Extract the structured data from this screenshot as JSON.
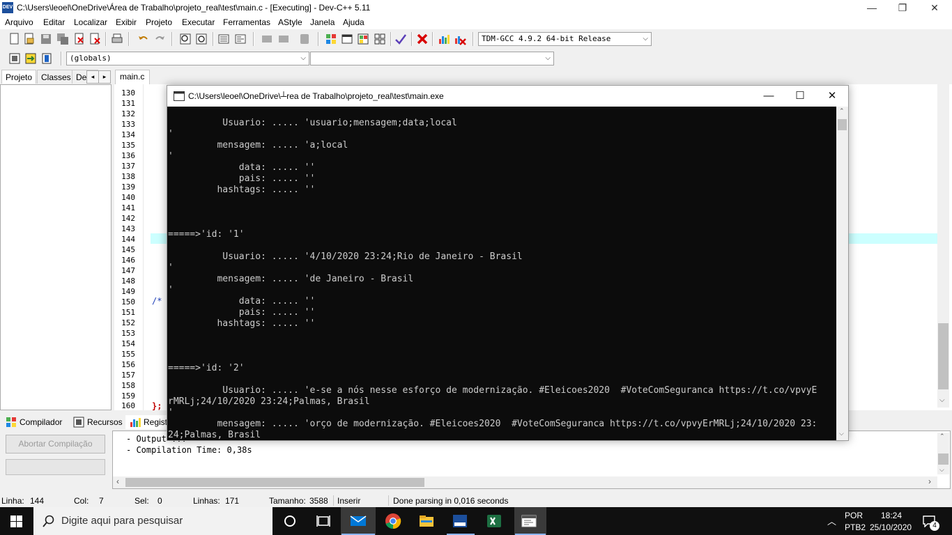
{
  "window": {
    "title": "C:\\Users\\leoel\\OneDrive\\Área de Trabalho\\projeto_real\\test\\main.c - [Executing] - Dev-C++ 5.11",
    "app_icon_text": "DEV",
    "minimize": "—",
    "maximize": "❐",
    "close": "✕"
  },
  "menu": [
    "Arquivo",
    "Editar",
    "Localizar",
    "Exibir",
    "Projeto",
    "Executar",
    "Ferramentas",
    "AStyle",
    "Janela",
    "Ajuda"
  ],
  "toolbar": {
    "compiler_select": "TDM-GCC 4.9.2 64-bit Release",
    "scope_select": "(globals)",
    "member_select": ""
  },
  "left_panel": {
    "tabs": [
      "Projeto",
      "Classes",
      "De"
    ]
  },
  "editor": {
    "tab": "main.c",
    "line_numbers": [
      "130",
      "131",
      "132",
      "133",
      "134",
      "135",
      "136",
      "137",
      "138",
      "139",
      "140",
      "141",
      "142",
      "143",
      "144",
      "145",
      "146",
      "147",
      "148",
      "149",
      "150",
      "151",
      "152",
      "153",
      "154",
      "155",
      "156",
      "157",
      "158",
      "159",
      "160"
    ],
    "comment_fragment": "/*",
    "closing_fragment": "};"
  },
  "bottom": {
    "tabs": [
      "Compilador",
      "Recursos",
      "Registr"
    ],
    "abort_button": "Abortar Compilação",
    "log": [
      "- Output ...",
      "- Compilation Time: 0,38s"
    ]
  },
  "status": {
    "linha_label": "Linha:",
    "linha": "144",
    "col_label": "Col:",
    "col": "7",
    "sel_label": "Sel:",
    "sel": "0",
    "linhas_label": "Linhas:",
    "linhas": "171",
    "tamanho_label": "Tamanho:",
    "tamanho": "3588",
    "mode": "Inserir",
    "message": "Done parsing in 0,016 seconds"
  },
  "console": {
    "title": "C:\\Users\\leoel\\OneDrive\\┴rea de Trabalho\\projeto_real\\test\\main.exe",
    "lines": [
      "          Usuario: ..... 'usuario;mensagem;data;local",
      "'",
      "         mensagem: ..... 'a;local",
      "'",
      "             data: ..... ''",
      "             pais: ..... ''",
      "         hashtags: ..... ''",
      "",
      "",
      "",
      "=====>'id: '1'",
      "",
      "          Usuario: ..... '4/10/2020 23:24;Rio de Janeiro - Brasil",
      "'",
      "         mensagem: ..... 'de Janeiro - Brasil",
      "'",
      "             data: ..... ''",
      "             pais: ..... ''",
      "         hashtags: ..... ''",
      "",
      "",
      "",
      "=====>'id: '2'",
      "",
      "          Usuario: ..... 'e-se a nós nesse esforço de modernização. #Eleicoes2020  #VoteComSeguranca https://t.co/vpvyE",
      "rMRLj;24/10/2020 23:24;Palmas, Brasil",
      "'",
      "         mensagem: ..... 'orço de modernização. #Eleicoes2020  #VoteComSeguranca https://t.co/vpvyErMRLj;24/10/2020 23:",
      "24;Palmas, Brasil"
    ]
  },
  "taskbar": {
    "search_placeholder": "Digite aqui para pesquisar",
    "lang": "POR",
    "layout": "PTB2",
    "time": "18:24",
    "date": "25/10/2020",
    "notifications": "4"
  }
}
